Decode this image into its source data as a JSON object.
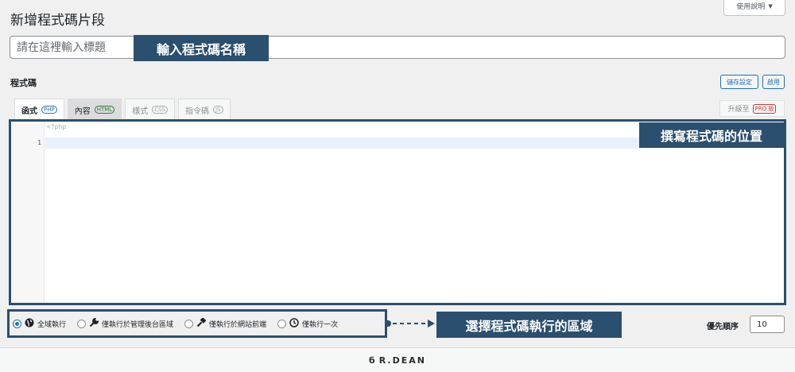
{
  "page": {
    "title": "新增程式碼片段",
    "help_button": "使用說明",
    "help_arrow": "▼"
  },
  "title_field": {
    "placeholder": "請在這裡輸入標題",
    "value": ""
  },
  "annotations": {
    "title_callout": "輸入程式碼名稱",
    "code_callout": "撰寫程式碼的位置",
    "scope_callout": "選擇程式碼執行的區域",
    "callout_color": "#2b4f6e"
  },
  "code_section": {
    "label": "程式碼",
    "save_button": "儲存設定",
    "enable_button": "啟用"
  },
  "tabs": [
    {
      "label": "函式",
      "badge": "PHP"
    },
    {
      "label": "內容",
      "badge": "HTML"
    },
    {
      "label": "樣式",
      "badge": "CSS"
    },
    {
      "label": "指令碼",
      "badge": "JS"
    }
  ],
  "upgrade": {
    "label": "升級至",
    "badge": "PRO 版"
  },
  "editor": {
    "php_open_tag": "<?php",
    "line_number": "1",
    "content": ""
  },
  "scope_options": [
    {
      "label": "全域執行",
      "icon": "globe-icon",
      "selected": true
    },
    {
      "label": "僅執行於管理後台區域",
      "icon": "wrench-icon",
      "selected": false
    },
    {
      "label": "僅執行於網站前端",
      "icon": "hammer-icon",
      "selected": false
    },
    {
      "label": "僅執行一次",
      "icon": "clock-icon",
      "selected": false
    }
  ],
  "priority": {
    "label": "優先順序",
    "value": "10"
  },
  "footer": {
    "brand": "R.DEAN",
    "logo_letter": "б"
  }
}
